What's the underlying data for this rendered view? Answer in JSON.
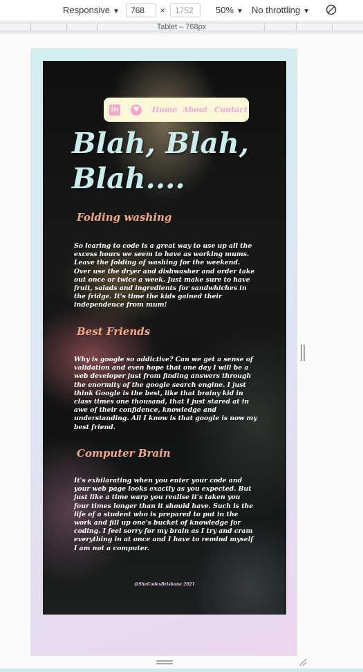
{
  "devtools": {
    "device": "Responsive",
    "width_value": "768",
    "dimension_separator": "×",
    "height_value": "1752",
    "zoom": "50%",
    "throttling": "No throttling",
    "caret": "▼",
    "breakpoint_label": "Tablet – 768px"
  },
  "navbar": {
    "icon_linkedin": "in",
    "icon_heart": "♥",
    "home": "Home",
    "about": "About",
    "contact": "Contact"
  },
  "hero": {
    "title_line1": "Blah, Blah,",
    "title_line2": "Blah...."
  },
  "sections": [
    {
      "heading": "Folding washing",
      "body": "So learing to code is a great way to use up all the excess hours we seem to have as working mums. Leave the folding of washing for the weekend. Over use the dryer and dishwasher and order take out once or twice a week. Just make sure to have fruit, salads and ingredients for sandwhiches in the fridge. It's time the kids gained their independence from mum!"
    },
    {
      "heading": "Best Friends",
      "body": "Why is google so addictive? Can we get a sense of validation and even hope that one day I will be a web developer just from finding answers through the enormity of the google search engine. I just think Google is the best, like that brainy kid in class times one thousand, that I just stared at in awe of their confidence, knowledge and understanding. All I know is that google is now my best friend."
    },
    {
      "heading": "Computer Brain",
      "body": "It's exhilarating when you enter your code and your web page looks exactly as you expected. But just like a time warp you realise it's taken you four times longer than it should have. Such is the life of a student who is prepared to put in the work and fill up one's bucket of knowledge for coding. I feel sorry for my brain as I try and cram everything in at once and I have to remind myself I am not a computer."
    }
  ],
  "footer": {
    "credit": "@SheCodesBrisbane 2021"
  },
  "colors": {
    "title": "#c9ecec",
    "heading": "#f4a882",
    "nav_bg": "#fbf8d6",
    "nav_text": "#f2a6e0",
    "icon_bg": "#f5a5d2"
  },
  "icons": [
    "linkedin-icon",
    "heart-icon",
    "rotate-icon",
    "resize-handle-icon"
  ]
}
